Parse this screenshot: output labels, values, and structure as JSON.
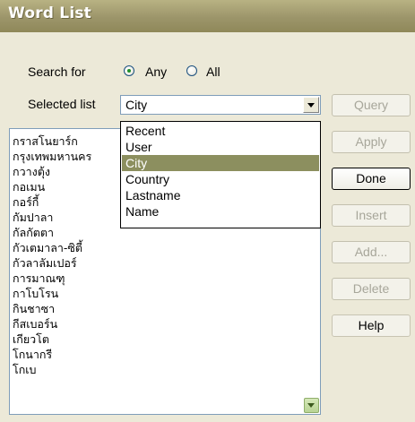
{
  "window": {
    "title": "Word List"
  },
  "search": {
    "label": "Search for",
    "options": [
      "Any",
      "All"
    ],
    "selected": "Any"
  },
  "selected_list": {
    "label": "Selected list",
    "value": "City"
  },
  "dropdown": {
    "items": [
      "Recent",
      "User",
      "City",
      "Country",
      "Lastname",
      "Name"
    ],
    "highlighted": "City"
  },
  "words": [
    "กราสโนยาร์ก",
    "กรุงเทพมหานคร",
    "กวางตุ้ง",
    "กอเมน",
    "กอร์กี้",
    "กัมปาลา",
    "กัลกัตตา",
    "กัวเตมาลา-ซิตี้",
    "กัวลาลัมเปอร์",
    "การมาณฑุ",
    "กาโบโรน",
    "กินชาซา",
    "กีสเบอร์น",
    "เกียวโต",
    "โกนากรี",
    "โกเบ"
  ],
  "buttons": {
    "query": "Query",
    "apply": "Apply",
    "done": "Done",
    "insert": "Insert",
    "add": "Add...",
    "delete": "Delete",
    "help": "Help"
  },
  "colors": {
    "title_bar": "#9c956a",
    "selection": "#8c8f5f",
    "background": "#ece9d8"
  }
}
